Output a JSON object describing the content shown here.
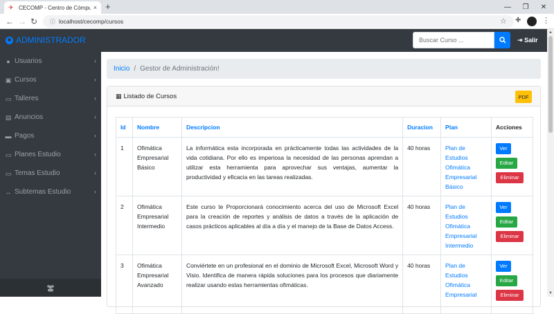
{
  "browser": {
    "tab_title": "CECOMP - Centro de Cómputo U",
    "url": "localhost/cecomp/cursos",
    "new_tab": "+",
    "close_tab": "×"
  },
  "navbar": {
    "brand": "ADMINISTRADOR",
    "search_placeholder": "Buscar Curso ...",
    "logout_label": "Salir"
  },
  "sidebar": {
    "items": [
      {
        "label": "Usuarios",
        "icon": "user-icon"
      },
      {
        "label": "Cursos",
        "icon": "cart-icon"
      },
      {
        "label": "Talleres",
        "icon": "folder-icon"
      },
      {
        "label": "Anuncios",
        "icon": "newspaper-icon"
      },
      {
        "label": "Pagos",
        "icon": "money-icon"
      },
      {
        "label": "Planes Estudio",
        "icon": "folder-icon"
      },
      {
        "label": "Temas Estudio",
        "icon": "folder-icon"
      },
      {
        "label": "Subtemas Estudio",
        "icon": "arrows-icon"
      }
    ]
  },
  "breadcrumb": {
    "home": "Inicio",
    "separator": "/",
    "current": "Gestor de Administración!"
  },
  "card": {
    "title": "Listado de Cursos",
    "pdf_label": "PDF"
  },
  "table": {
    "headers": [
      "Id",
      "Nombre",
      "Descripcion",
      "Duracion",
      "Plan",
      "Acciones"
    ],
    "rows": [
      {
        "id": "1",
        "nombre": "Ofimática Empresarial Básico",
        "descripcion": "La informática esta incorporada en prácticamente todas las actividades de la vida cotidiana. Por ello es imperiosa la necesidad de las personas aprendan a utilizar esta herramienta para aprovechar sus ventajas, aumentar la productividad y eficacia en las tareas realizadas.",
        "duracion": "40 horas",
        "plan": "Plan de Estudios Ofimática Empresarial Básico"
      },
      {
        "id": "2",
        "nombre": "Ofimática Empresarial Intermedio",
        "descripcion": "Este curso te Proporcionará conocimiento acerca del uso de Microsoft Excel para la creación de reportes y análisis de datos a través de la aplicación de casos prácticos aplicables al día a día y el manejo de la Base de Datos Access.",
        "duracion": "40 horas",
        "plan": "Plan de Estudios Ofimática Empresarial Intermedio"
      },
      {
        "id": "3",
        "nombre": "Ofimática Empresarial Avanzado",
        "descripcion": "Conviértete en un profesional en el dominio de Microsoft Excel, Microsoft Word y Visio. Identifica de manera rápida soluciones para los procesos que diariamente realizar usando estas herramientas ofimáticas.",
        "duracion": "40 horas",
        "plan": "Plan de Estudios Ofimática Empresarial"
      }
    ],
    "actions": {
      "ver": "Ver",
      "editar": "Editar",
      "eliminar": "Eliminar"
    }
  },
  "colors": {
    "navbar_bg": "#343a40",
    "primary": "#007bff",
    "success": "#28a745",
    "danger": "#dc3545",
    "warning": "#ffc107"
  }
}
